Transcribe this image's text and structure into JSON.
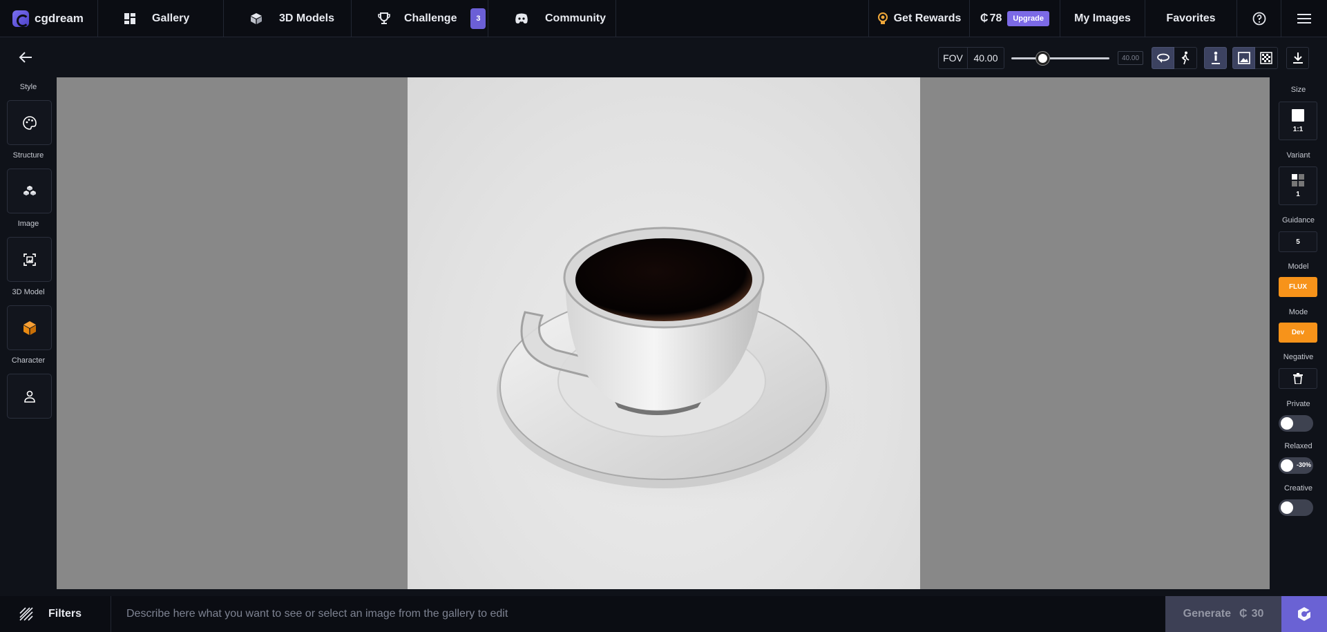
{
  "nav": {
    "brand": "cgdream",
    "gallery": "Gallery",
    "models3d": "3D Models",
    "challenge": "Challenge",
    "challenge_badge": "3",
    "community": "Community",
    "rewards": "Get Rewards",
    "credits": "78",
    "upgrade": "Upgrade",
    "my_images": "My Images",
    "favorites": "Favorites",
    "icons": [
      "gallery-grid-icon",
      "cube-icon",
      "trophy-icon",
      "discord-icon",
      "reward-icon",
      "coin-icon",
      "help-icon",
      "menu-icon"
    ]
  },
  "toolbar": {
    "fov_label": "FOV",
    "fov_value": "40.00",
    "fov_box": "40.00",
    "fov_slider_fraction": 0.3,
    "icons": [
      "back-arrow-icon",
      "orbit-icon",
      "walk-icon",
      "person-height-icon",
      "image-icon",
      "checker-icon",
      "download-icon"
    ]
  },
  "left_tools": [
    {
      "label": "Style",
      "icon": "palette-icon"
    },
    {
      "label": "Structure",
      "icon": "structure-icon"
    },
    {
      "label": "Image",
      "icon": "image-frame-icon"
    },
    {
      "label": "3D Model",
      "icon": "orange-cube-icon"
    },
    {
      "label": "Character",
      "icon": "person-icon"
    }
  ],
  "right_panel": {
    "size_label": "Size",
    "size_value": "1:1",
    "variant_label": "Variant",
    "variant_value": "1",
    "guidance_label": "Guidance",
    "guidance_value": "5",
    "model_label": "Model",
    "model_value": "FLUX",
    "mode_label": "Mode",
    "mode_value": "Dev",
    "negative_label": "Negative",
    "private_label": "Private",
    "relaxed_label": "Relaxed",
    "relaxed_tag": "-30%",
    "creative_label": "Creative",
    "accent_color": "#f7931a"
  },
  "bottom": {
    "filters": "Filters",
    "prompt_placeholder": "Describe here what you want to see or select an image from the gallery to edit",
    "generate": "Generate",
    "generate_cost": "30"
  }
}
